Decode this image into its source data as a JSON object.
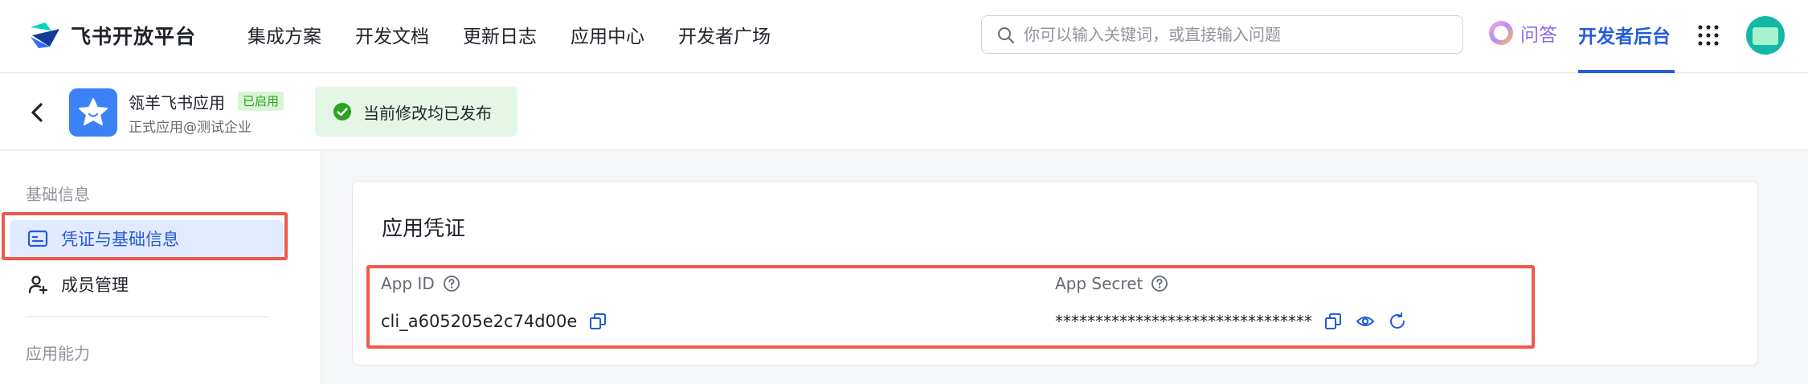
{
  "brand": {
    "name": "飞书开放平台"
  },
  "nav": {
    "items": [
      "集成方案",
      "开发文档",
      "更新日志",
      "应用中心",
      "开发者广场"
    ]
  },
  "search": {
    "placeholder": "你可以输入关键词，或直接输入问题"
  },
  "header_right": {
    "qa_label": "问答",
    "dev_backend_label": "开发者后台"
  },
  "app": {
    "name": "瓴羊飞书应用",
    "status": "已启用",
    "subtitle": "正式应用@测试企业",
    "publish_status": "当前修改均已发布"
  },
  "sidebar": {
    "section1": "基础信息",
    "items": [
      {
        "label": "凭证与基础信息",
        "active": true,
        "icon": "credential-card-icon"
      },
      {
        "label": "成员管理",
        "active": false,
        "icon": "person-add-icon"
      }
    ],
    "section2": "应用能力"
  },
  "credentials": {
    "title": "应用凭证",
    "app_id_label": "App ID",
    "app_id_value": "cli_a605205e2c74d00e",
    "app_secret_label": "App Secret",
    "app_secret_value": "********************************"
  },
  "colors": {
    "accent": "#245bdb",
    "highlight": "#ef5a4c",
    "success": "#2ea121",
    "qa_purple": "#8c67f0"
  }
}
